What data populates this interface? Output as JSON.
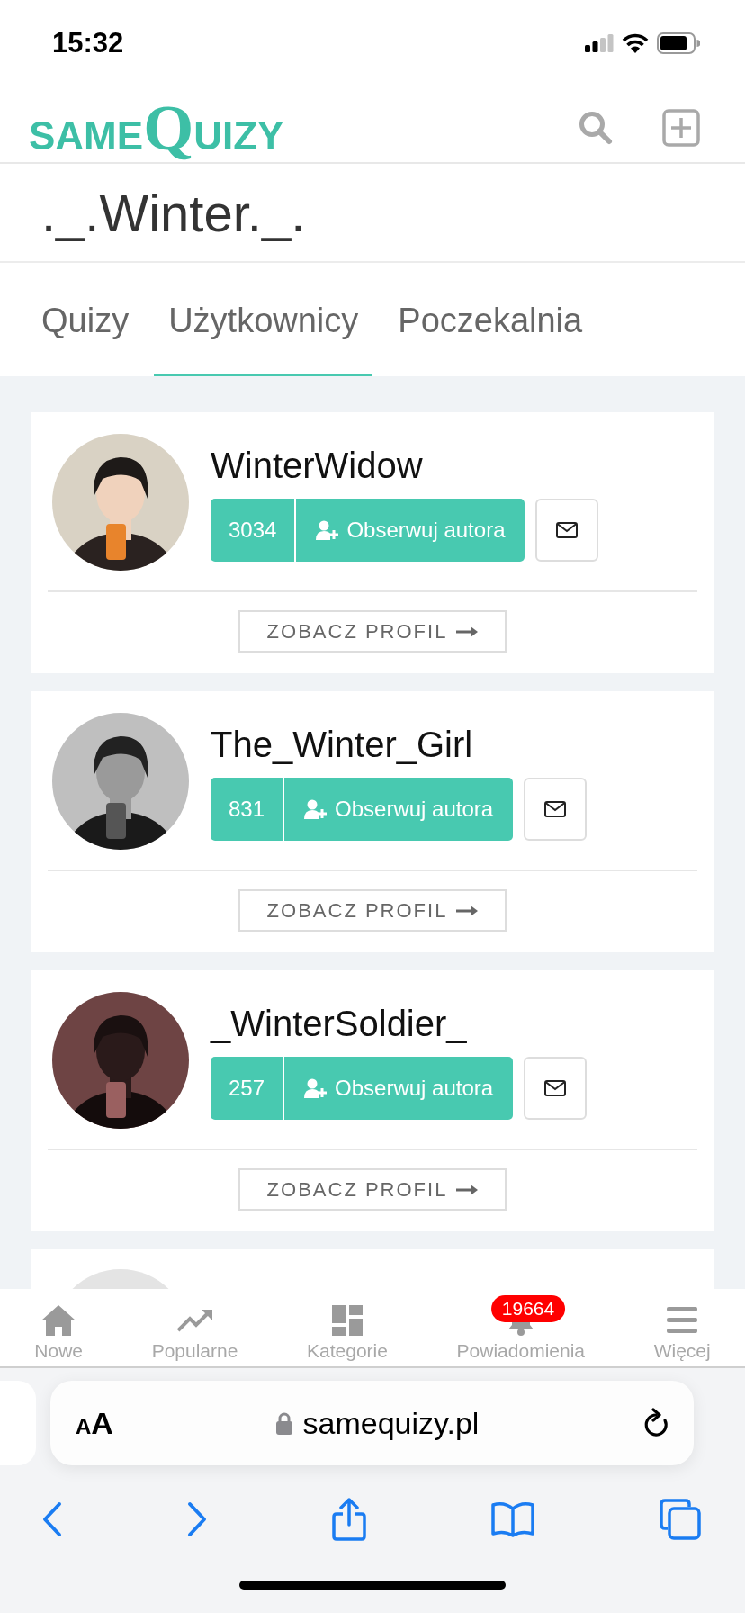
{
  "status_bar": {
    "time": "15:32"
  },
  "header": {
    "logo": {
      "lead": "SAME",
      "initial": "Q",
      "rest": "UIZY"
    }
  },
  "page_title": "._.Winter._.",
  "tabs": [
    {
      "label": "Quizy",
      "selected": false
    },
    {
      "label": "Użytkownicy",
      "selected": true
    },
    {
      "label": "Poczekalnia",
      "selected": false
    }
  ],
  "users": [
    {
      "name": "WinterWidow",
      "followers": "3034",
      "follow_label": "Obserwuj autora",
      "profile_label": "ZOBACZ PROFIL"
    },
    {
      "name": "The_Winter_Girl",
      "followers": "831",
      "follow_label": "Obserwuj autora",
      "profile_label": "ZOBACZ PROFIL"
    },
    {
      "name": "_WinterSoldier_",
      "followers": "257",
      "follow_label": "Obserwuj autora",
      "profile_label": "ZOBACZ PROFIL"
    }
  ],
  "bottom_nav": [
    {
      "kind": "home",
      "label": "Nowe"
    },
    {
      "kind": "trending",
      "label": "Popularne"
    },
    {
      "kind": "grid",
      "label": "Kategorie"
    },
    {
      "kind": "bell",
      "label": "Powiadomienia",
      "badge": "19664"
    },
    {
      "kind": "menu",
      "label": "Więcej"
    }
  ],
  "browser": {
    "text_size_label": "AA",
    "url": "samequizy.pl"
  }
}
